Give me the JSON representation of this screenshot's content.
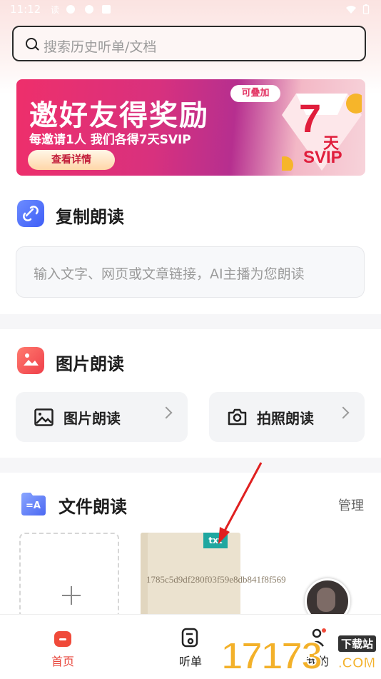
{
  "status": {
    "time": "11:12"
  },
  "search": {
    "placeholder": "搜索历史听单/文档"
  },
  "banner": {
    "headline": "邀好友得奖励",
    "subline": "每邀请1人 我们各得7天SVIP",
    "button": "查看详情",
    "tag": "可叠加",
    "big_number": "7",
    "unit": "天",
    "svip": "SVIP"
  },
  "copy_read": {
    "title": "复制朗读",
    "placeholder": "输入文字、网页或文章链接，AI主播为您朗读"
  },
  "image_read": {
    "title": "图片朗读",
    "buttons": [
      {
        "label": "图片朗读"
      },
      {
        "label": "拍照朗读"
      }
    ]
  },
  "file_read": {
    "title": "文件朗读",
    "manage": "管理",
    "files": [
      {
        "badge": "txt",
        "name": "1785c5d9df280f03f59e8db841f8f569"
      }
    ]
  },
  "tabbar": {
    "items": [
      {
        "label": "首页",
        "active": true
      },
      {
        "label": "听单",
        "active": false
      },
      {
        "label": "我的",
        "active": false
      }
    ]
  },
  "watermark": {
    "number": "17173",
    "site": "下载站",
    "domain": ".COM"
  },
  "colors": {
    "accent": "#e8463c",
    "banner_pink": "#ee2f6b",
    "badge_teal": "#1fa7a0"
  }
}
